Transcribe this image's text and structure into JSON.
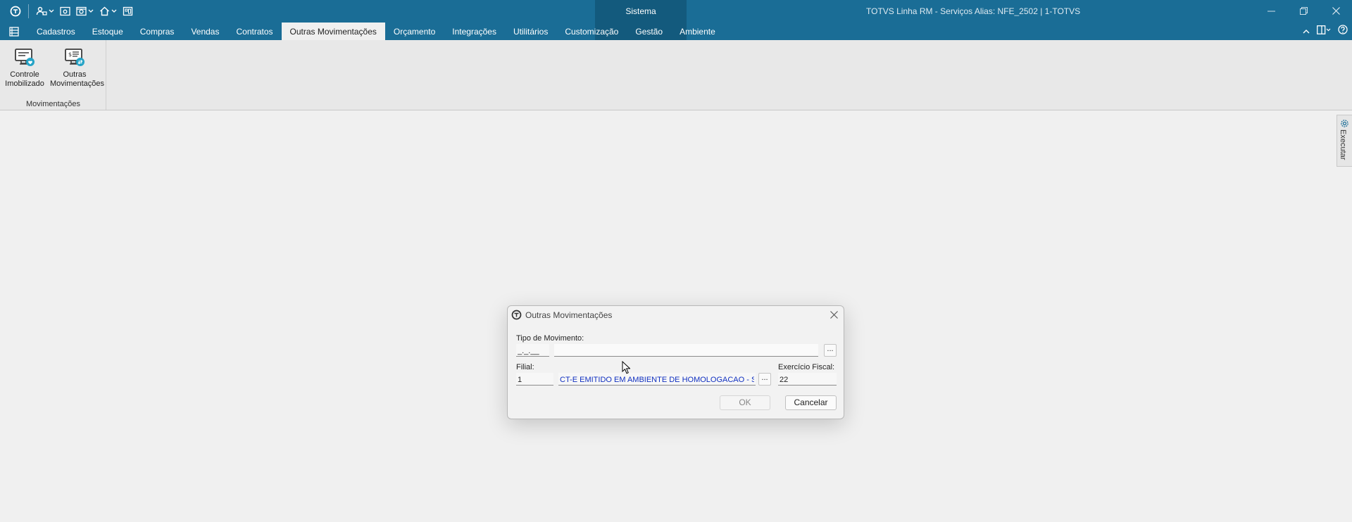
{
  "titlebar": {
    "sistema": "Sistema",
    "window_title": "TOTVS Linha RM - Serviços  Alias: NFE_2502 | 1-TOTVS"
  },
  "tabs": [
    "Cadastros",
    "Estoque",
    "Compras",
    "Vendas",
    "Contratos",
    "Outras Movimentações",
    "Orçamento",
    "Integrações",
    "Utilitários",
    "Customização",
    "Gestão",
    "Ambiente"
  ],
  "active_tab": "Outras Movimentações",
  "ribbon": {
    "buttons": [
      {
        "line1": "Controle",
        "line2": "Imobilizado",
        "icon": "monitor-heart-icon"
      },
      {
        "line1": "Outras",
        "line2": "Movimentações",
        "icon": "monitor-list-icon"
      }
    ],
    "group_label": "Movimentações"
  },
  "side_tab": {
    "label": "Executar"
  },
  "dialog": {
    "title": "Outras Movimentações",
    "tipo_label": "Tipo de Movimento:",
    "tipo_code": "_._.__",
    "tipo_desc": "",
    "filial_label": "Filial:",
    "filial_code": "1",
    "filial_desc": "CT-E EMITIDO EM AMBIENTE DE HOMOLOGACAO - SI",
    "exercicio_label": "Exercício Fiscal:",
    "exercicio_value": "22",
    "ellipsis": "...",
    "ok": "OK",
    "cancel": "Cancelar"
  },
  "colors": {
    "titlebar": "#1a6d96",
    "sistema_block": "#135a7d",
    "ribbon": "#e8e8e8",
    "desc_text": "#1030c0"
  }
}
